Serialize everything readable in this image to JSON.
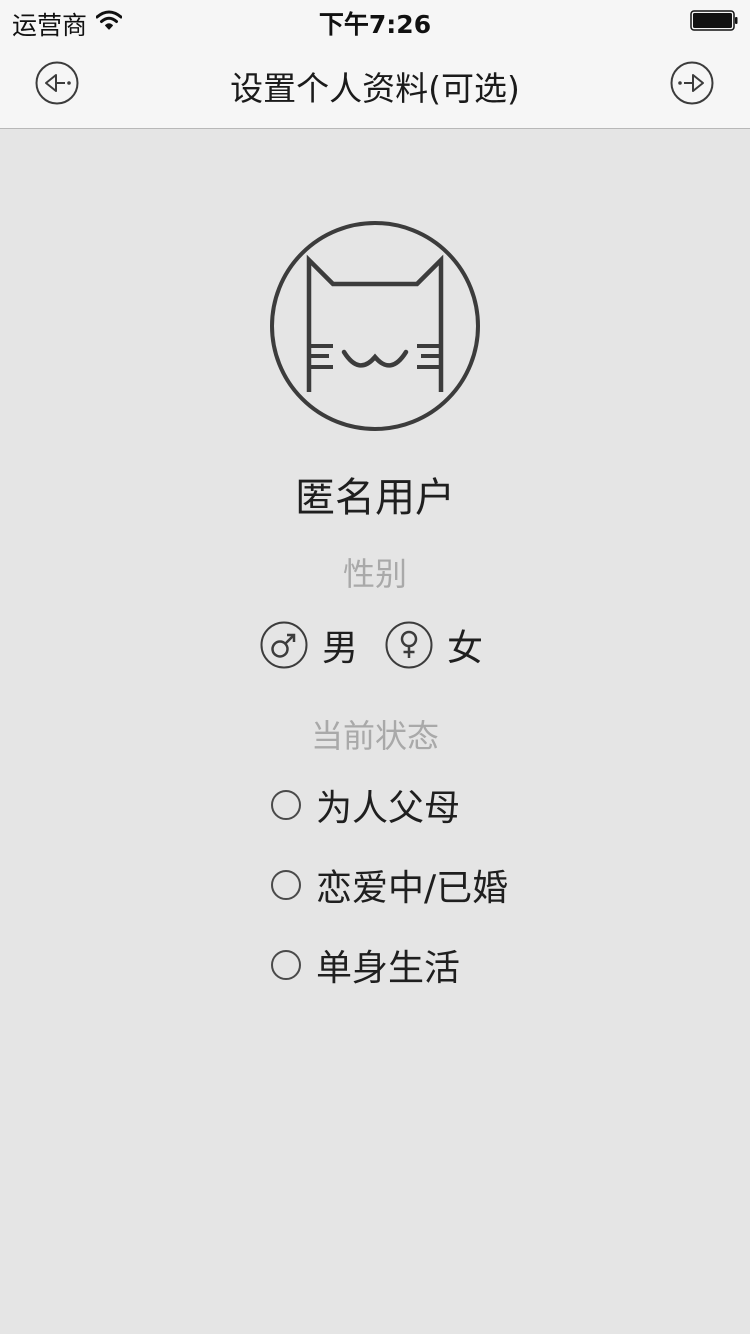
{
  "status_bar": {
    "carrier": "运营商",
    "time": "下午7:26",
    "wifi_icon": "wifi-icon",
    "battery_icon": "battery-icon"
  },
  "nav": {
    "title": "设置个人资料(可选)",
    "back_icon": "arrow-left-circle-icon",
    "next_icon": "arrow-right-circle-icon"
  },
  "profile": {
    "avatar_icon": "cat-face-icon",
    "name": "匿名用户"
  },
  "gender": {
    "label": "性别",
    "options": [
      {
        "label": "男",
        "icon": "male-symbol-icon"
      },
      {
        "label": "女",
        "icon": "female-symbol-icon"
      }
    ]
  },
  "relationship": {
    "label": "当前状态",
    "options": [
      {
        "label": "为人父母",
        "selected": false
      },
      {
        "label": "恋爱中/已婚",
        "selected": false
      },
      {
        "label": "单身生活",
        "selected": false
      }
    ]
  },
  "colors": {
    "background": "#e5e5e5",
    "nav_background": "#f6f6f6",
    "icon_stroke": "#3c3c3c",
    "hint_text": "#a9a9a9"
  }
}
